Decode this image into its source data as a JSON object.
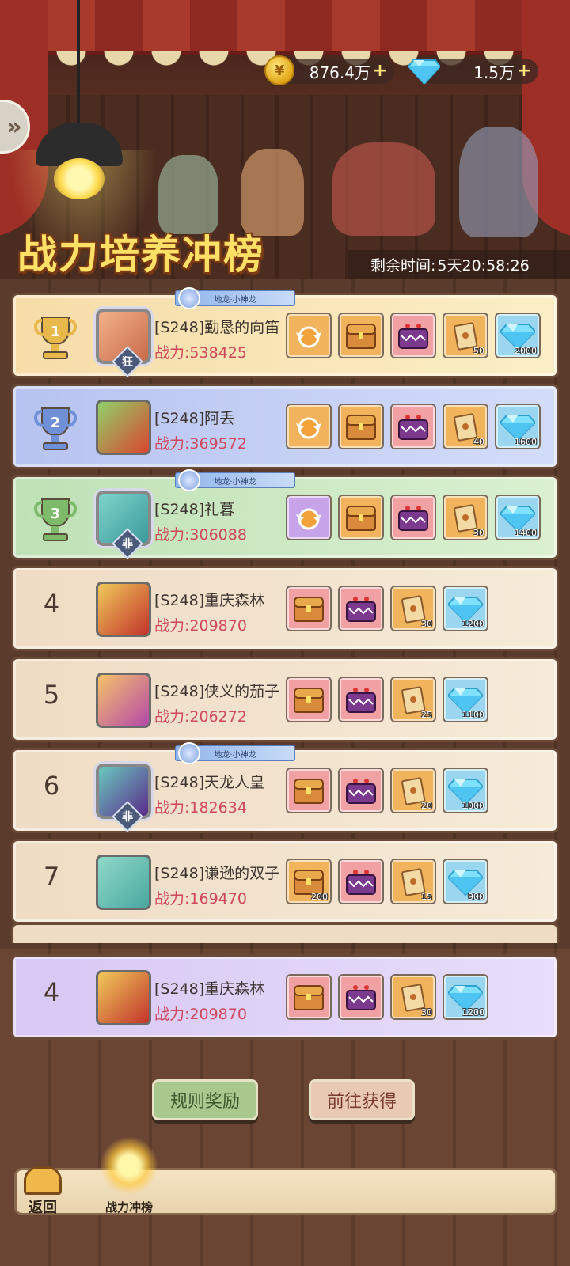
{
  "header": {
    "title": "战力培养冲榜",
    "remaining_label": "剩余时间:",
    "remaining_value": "5天20:58:26",
    "gold_value": "876.4万",
    "gem_value": "1.5万",
    "plus": "+"
  },
  "vip_badge_text": "地龙·小神龙",
  "rows": [
    {
      "rank": "1",
      "name": "[S248]勤恳的向笛",
      "power": "战力:538425",
      "tag": "狂",
      "rewards": [
        {
          "icon": "medal-icon",
          "qty": ""
        },
        {
          "icon": "chest-icon",
          "qty": ""
        },
        {
          "icon": "monster-chest-icon",
          "qty": ""
        },
        {
          "icon": "ticket-icon",
          "qty": "50"
        },
        {
          "icon": "diamond-icon",
          "qty": "2000"
        }
      ]
    },
    {
      "rank": "2",
      "name": "[S248]阿丢",
      "power": "战力:369572",
      "rewards": [
        {
          "icon": "medal-icon",
          "qty": ""
        },
        {
          "icon": "chest-icon",
          "qty": ""
        },
        {
          "icon": "monster-chest-icon",
          "qty": ""
        },
        {
          "icon": "ticket-icon",
          "qty": "40"
        },
        {
          "icon": "diamond-icon",
          "qty": "1600"
        }
      ]
    },
    {
      "rank": "3",
      "name": "[S248]礼暮",
      "power": "战力:306088",
      "tag": "非",
      "rewards": [
        {
          "icon": "medal-icon",
          "qty": ""
        },
        {
          "icon": "chest-icon",
          "qty": ""
        },
        {
          "icon": "monster-chest-icon",
          "qty": ""
        },
        {
          "icon": "ticket-icon",
          "qty": "30"
        },
        {
          "icon": "diamond-icon",
          "qty": "1400"
        }
      ]
    },
    {
      "rank": "4",
      "name": "[S248]重庆森林",
      "power": "战力:209870",
      "rewards": [
        {
          "icon": "chest-icon",
          "qty": ""
        },
        {
          "icon": "monster-chest-icon",
          "qty": ""
        },
        {
          "icon": "ticket-icon",
          "qty": "30"
        },
        {
          "icon": "diamond-icon",
          "qty": "1200"
        }
      ]
    },
    {
      "rank": "5",
      "name": "[S248]侠义的茄子",
      "power": "战力:206272",
      "rewards": [
        {
          "icon": "chest-icon",
          "qty": ""
        },
        {
          "icon": "monster-chest-icon",
          "qty": ""
        },
        {
          "icon": "ticket-icon",
          "qty": "25"
        },
        {
          "icon": "diamond-icon",
          "qty": "1100"
        }
      ]
    },
    {
      "rank": "6",
      "name": "[S248]天龙人皇",
      "power": "战力:182634",
      "tag": "非",
      "rewards": [
        {
          "icon": "chest-icon",
          "qty": ""
        },
        {
          "icon": "monster-chest-icon",
          "qty": ""
        },
        {
          "icon": "ticket-icon",
          "qty": "20"
        },
        {
          "icon": "diamond-icon",
          "qty": "1000"
        }
      ]
    },
    {
      "rank": "7",
      "name": "[S248]谦逊的双子",
      "power": "战力:169470",
      "rewards": [
        {
          "icon": "chest-icon",
          "qty": "200"
        },
        {
          "icon": "monster-chest-icon",
          "qty": ""
        },
        {
          "icon": "ticket-icon",
          "qty": "15"
        },
        {
          "icon": "diamond-icon",
          "qty": "900"
        }
      ]
    }
  ],
  "my_row": {
    "rank": "4",
    "name": "[S248]重庆森林",
    "power": "战力:209870",
    "rewards": [
      {
        "icon": "chest-icon",
        "qty": ""
      },
      {
        "icon": "monster-chest-icon",
        "qty": ""
      },
      {
        "icon": "ticket-icon",
        "qty": "30"
      },
      {
        "icon": "diamond-icon",
        "qty": "1200"
      }
    ]
  },
  "buttons": {
    "rules": "规则奖励",
    "go": "前往获得"
  },
  "nav": {
    "back": "返回",
    "tab": "战力冲榜"
  },
  "colors": {
    "title": "#ffe066",
    "power": "#d0465a"
  }
}
